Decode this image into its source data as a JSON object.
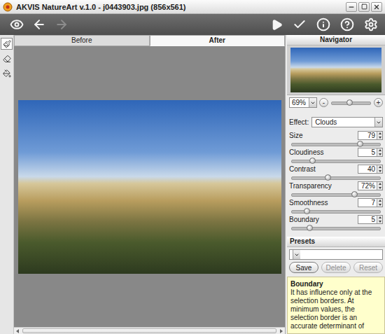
{
  "window": {
    "title": "AKVIS NatureArt v.1.0 - j0443903.jpg (856x561)"
  },
  "toolbar": {
    "left": [
      {
        "kind": "before-after",
        "disabled": false
      },
      {
        "kind": "back",
        "disabled": false
      },
      {
        "kind": "forward",
        "disabled": true
      }
    ],
    "right": [
      {
        "kind": "run",
        "disabled": false
      },
      {
        "kind": "apply",
        "disabled": false
      },
      {
        "kind": "about",
        "disabled": false
      },
      {
        "kind": "help",
        "disabled": false
      },
      {
        "kind": "settings",
        "disabled": false
      }
    ]
  },
  "tools": [
    {
      "kind": "brush",
      "selected": true
    },
    {
      "kind": "eraser",
      "selected": false
    },
    {
      "kind": "bucket",
      "selected": false
    }
  ],
  "tabs": [
    {
      "label": "Before",
      "selected": false
    },
    {
      "label": "After",
      "selected": true
    }
  ],
  "navigator": {
    "title": "Navigator",
    "zoom": "69%",
    "zoom_out": "-",
    "zoom_in": "+",
    "level": 0.45
  },
  "effect": {
    "label": "Effect:",
    "value": "Clouds"
  },
  "parameters": [
    {
      "label": "Size",
      "value": "79",
      "level": 0.78
    },
    {
      "label": "Cloudiness",
      "value": "5",
      "level": 0.22
    },
    {
      "label": "Contrast",
      "value": "40",
      "level": 0.4
    },
    {
      "label": "Transparency",
      "value": "72%",
      "level": 0.72
    },
    {
      "label": "Smoothness",
      "value": "7",
      "level": 0.15
    },
    {
      "label": "Boundary",
      "value": "5",
      "level": 0.18
    }
  ],
  "presets": {
    "title": "Presets",
    "value": "",
    "buttons": [
      {
        "label": "Save",
        "disabled": false
      },
      {
        "label": "Delete",
        "disabled": true
      },
      {
        "label": "Reset",
        "disabled": true
      }
    ]
  },
  "help": {
    "title": "Boundary",
    "text": "It has influence only at the selection borders. At minimum values, the selection border is an accurate determinant of"
  }
}
